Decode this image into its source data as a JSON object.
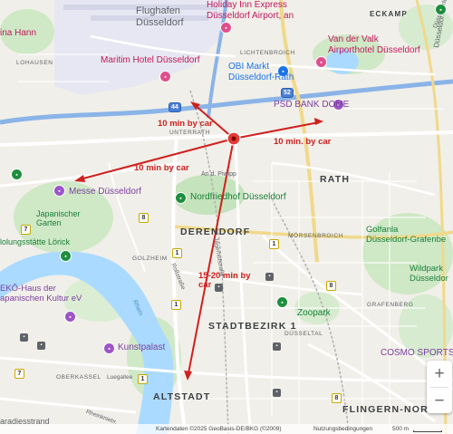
{
  "districts": {
    "eckamp": "ECKAMP",
    "rath": "RATH",
    "derendorf": "DERENDORF",
    "stadtbezirk": "STADTBEZIRK 1",
    "altstadt": "ALTSTADT",
    "flingern": "FLINGERN-NORD",
    "lohausen": "LOHAUSEN",
    "lichtenbroich": "LICHTENBROICH",
    "unterrath": "UNTERRATH",
    "golzheim": "GOLZHEIM",
    "moersenbroich": "MÖRSENBROICH",
    "duesseltal": "DÜSSELTAL",
    "grafenberg": "GRAFENBERG",
    "oberkassel": "OBERKASSEL"
  },
  "streets": {
    "an_d_piwipp": "An d. Piwipp",
    "rossstrasse": "Roßstraße",
    "jaegerhof": "Jägerhofstraße",
    "luegallee": "Luegallee",
    "rheinkniebr": "Rheinkniebr.",
    "duesseldorfer": "Düsseldorfer Str."
  },
  "water": {
    "rhein": "Rhein"
  },
  "pois": {
    "flughafen": "Flughafen\nDüsseldorf",
    "holiday_inn": "Holiday Inn Express\nDüsseldorf Airport, an",
    "van_der_valk": "Van der Valk\nAirporthotel Düsseldorf",
    "maritim": "Maritim Hotel Düsseldorf",
    "obi": "OBI Markt\nDüsseldorf-Rath",
    "psd": "PSD BANK DOME",
    "messe": "Messe Düsseldorf",
    "japanischer": "Japanischer\nGarten",
    "nordfriedhof": "Nordfriedhof Düsseldorf",
    "loerick": "lolungsstätte Lörick",
    "eko": "EKŌ-Haus der\napanischen Kultur eV",
    "kunstpalast": "Kunstpalast",
    "zoopark": "Zoopark",
    "golfanlage": "Golfanla\nDüsseldorf-Grafenbe",
    "wildpark": "Wildpark\nDüsseldor",
    "cosmo": "COSMO SPORTS",
    "ina_hann": "ina Hann",
    "paradiesstrand": "aradiesstrand",
    "duesseldorf_edge": "Düsseldorf"
  },
  "annotations": {
    "top_left": "10 min by car",
    "right": "10 min. by car",
    "left": "10 min by car",
    "down": "15-20 min by\ncar"
  },
  "badges": [
    "44",
    "52",
    "8",
    "7",
    "1",
    "1",
    "8",
    "1",
    "8",
    "7",
    "1"
  ],
  "zoom": {
    "in": "+",
    "out": "−"
  },
  "attribution": {
    "data": "Kartendaten ©2025 GeoBasis-DE/BKG (©2009)",
    "terms": "Nutzungsbedingungen",
    "scale": "500 m"
  },
  "colors": {
    "arrow": "#d0201e",
    "water": "#aadaff",
    "park": "#c8e6c1",
    "airport": "#e8eaf6",
    "highway": "#8ab4e8",
    "road": "#ffffff"
  }
}
